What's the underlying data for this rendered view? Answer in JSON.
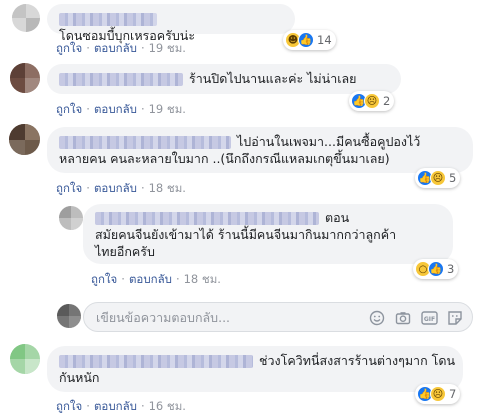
{
  "actions": {
    "like": "ถูกใจ",
    "reply": "ตอบกลับ",
    "separator": "·"
  },
  "comments": [
    {
      "lines": [
        "โดนซอมบี้บุกเหรอครับน่ะ"
      ],
      "time": "19 ชม.",
      "reactions": {
        "icons": [
          "haha-icon",
          "like-icon"
        ],
        "count": "14"
      }
    },
    {
      "lines": [
        "ร้านปิดไปนานและค่ะ ไม่น่าเลย"
      ],
      "time": "19 ชม.",
      "reactions": {
        "icons": [
          "like-icon",
          "sad-icon"
        ],
        "count": "2"
      }
    },
    {
      "lines": [
        "ไปอ่านในเพจมา...มีคนซื้อคูปองไว้",
        "หลายคน คนละหลายใบมาก ..(นึกถึงกรณีแหลมเกตุขึ้นมาเลย)"
      ],
      "time": "18 ชม.",
      "reactions": {
        "icons": [
          "like-icon",
          "sad-icon"
        ],
        "count": "5"
      }
    },
    {
      "lines": [
        "ตอน",
        "สมัยคนจีนยังเข้ามาได้ ร้านนี้มีคนจีนมากินมากกว่าลูกค้า",
        "ไทยอีกครับ"
      ],
      "time": "18 ชม.",
      "reactions": {
        "icons": [
          "wow-icon",
          "like-icon"
        ],
        "count": "3"
      }
    },
    {
      "lines": [
        "ช่วงโควิทนี่สงสารร้านต่างๆมาก โดน",
        "กันหนัก"
      ],
      "time": "16 ชม.",
      "reactions": {
        "icons": [
          "like-icon",
          "sad-icon"
        ],
        "count": "7"
      }
    }
  ],
  "reply_box": {
    "placeholder": "เขียนข้อความตอบกลับ..."
  },
  "colors": {
    "link": "#385898",
    "bubble": "#f2f3f5",
    "meta": "#90949c",
    "like": "#1877f2",
    "emoji": "#f7c739"
  }
}
